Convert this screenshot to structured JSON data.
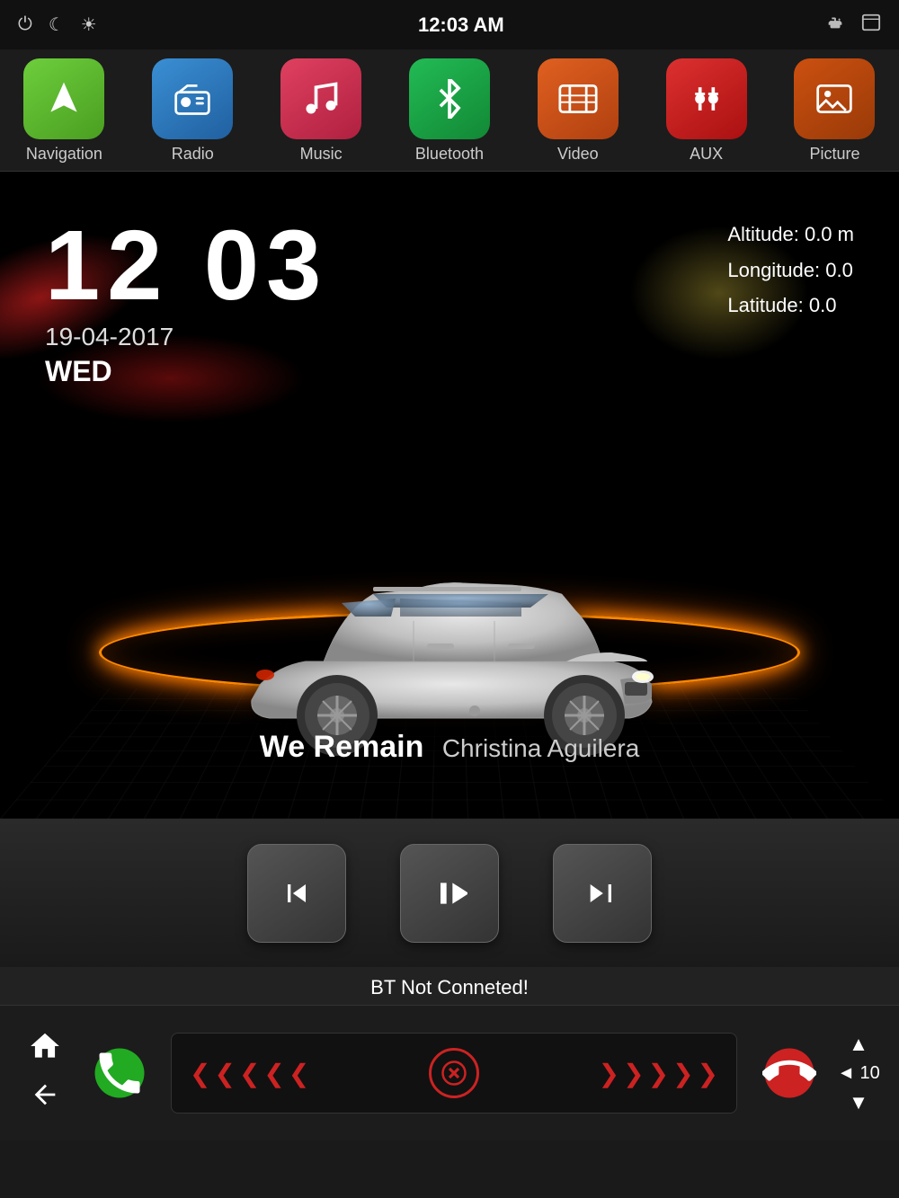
{
  "statusBar": {
    "time": "12:03 AM",
    "powerIcon": "⏻",
    "moonIcon": "☾",
    "sunIcon": "☀",
    "usbIcon": "⚡",
    "windowIcon": "⬜"
  },
  "appBar": {
    "apps": [
      {
        "id": "navigation",
        "label": "Navigation",
        "icon": "▲",
        "iconClass": "icon-nav"
      },
      {
        "id": "radio",
        "label": "Radio",
        "icon": "📻",
        "iconClass": "icon-radio"
      },
      {
        "id": "music",
        "label": "Music",
        "icon": "♪",
        "iconClass": "icon-music"
      },
      {
        "id": "bluetooth",
        "label": "Bluetooth",
        "icon": "⌘",
        "iconClass": "icon-bluetooth"
      },
      {
        "id": "video",
        "label": "Video",
        "icon": "🎞",
        "iconClass": "icon-video"
      },
      {
        "id": "aux",
        "label": "AUX",
        "icon": "🔌",
        "iconClass": "icon-aux"
      },
      {
        "id": "picture",
        "label": "Picture",
        "icon": "🖼",
        "iconClass": "icon-picture"
      }
    ]
  },
  "mainDisplay": {
    "timeHours": "12",
    "timeMinutes": "03",
    "date": "19-04-2017",
    "day": "WED",
    "altitude": "Altitude:  0.0 m",
    "longitude": "Longitude:  0.0",
    "latitude": "Latitude:  0.0",
    "songTitle": "We Remain",
    "songArtist": "Christina Aguilera"
  },
  "playerControls": {
    "prevLabel": "⏮",
    "playPauseLabel": "⏯",
    "nextLabel": "⏭"
  },
  "bottomBar": {
    "btStatus": "BT Not Conneted!",
    "homeIcon": "⌂",
    "backIcon": "←",
    "volUp": "▲",
    "volDown": "▼",
    "volLabel": "◄ 10"
  }
}
